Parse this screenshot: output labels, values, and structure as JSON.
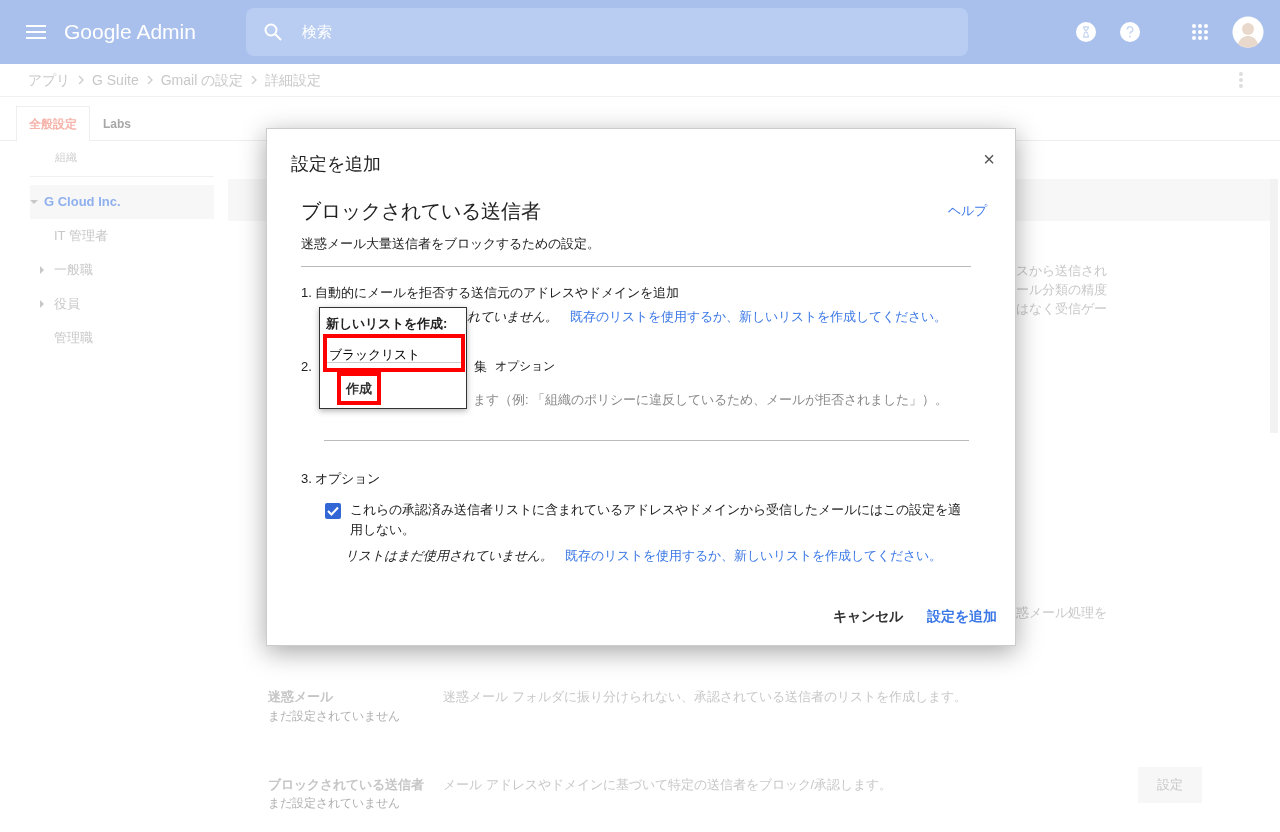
{
  "header": {
    "logo": "Google Admin",
    "search": {
      "placeholder": "検索"
    }
  },
  "breadcrumbs": [
    "アプリ",
    "G Suite",
    "Gmail の設定",
    "詳細設定"
  ],
  "tabs": [
    {
      "label": "全般設定",
      "selected": true
    },
    {
      "label": "Labs",
      "selected": false
    }
  ],
  "sidebar": {
    "heading": "組織",
    "tree": [
      {
        "label": "G Cloud Inc.",
        "selected": true,
        "expanded": true,
        "children": [
          {
            "label": "IT 管理者",
            "selected": false,
            "expandable": false
          },
          {
            "label": "一般職",
            "selected": false,
            "expandable": true
          },
          {
            "label": "役員",
            "selected": false,
            "expandable": true
          },
          {
            "label": "管理職",
            "selected": false,
            "expandable": false
          }
        ]
      }
    ]
  },
  "background": {
    "fragments": [
      "スから送信され",
      "ール分類の精度",
      "はなく受信ゲー"
    ],
    "fragment_lower": "惑メール処理を",
    "settings": [
      {
        "title": "迷惑メール",
        "status": "まだ設定されていません",
        "description": "迷惑メール フォルダに振り分けられない、承認されている送信者のリストを作成します。"
      },
      {
        "title": "ブロックされている送信者",
        "status": "まだ設定されていません",
        "description": "メール アドレスやドメインに基づいて特定の送信者をブロック/承認します。",
        "button": "設定"
      }
    ]
  },
  "dialog": {
    "title": "設定を追加",
    "close": "×",
    "heading": "ブロックされている送信者",
    "help": "ヘルプ",
    "description": "迷惑メール大量送信者をブロックするための設定。",
    "step1": {
      "label": "1. 自動的にメールを拒否する送信元のアドレスやドメインを追加",
      "note_visible": "れていません。",
      "link": "既存のリストを使用するか、新しいリストを作成してください。"
    },
    "step2": {
      "number": "2.",
      "label_visible": "集",
      "optional": "オプション",
      "hint_visible": "ます（例: 「組織のポリシーに違反しているため、メールが拒否されました」）。"
    },
    "step3": {
      "label": "3. オプション",
      "checkbox": {
        "checked": true,
        "label": "これらの承認済み送信者リストに含まれているアドレスやドメインから受信したメールにはこの設定を適用しない。"
      },
      "note": "リストはまだ使用されていません。",
      "link": "既存のリストを使用するか、新しいリストを作成してください。"
    },
    "buttons": [
      {
        "label": "キャンセル",
        "primary": false
      },
      {
        "label": "設定を追加",
        "primary": true
      }
    ],
    "popup": {
      "title": "新しいリストを作成:",
      "input_value": "ブラックリスト",
      "button": "作成",
      "highlighted": true
    }
  }
}
